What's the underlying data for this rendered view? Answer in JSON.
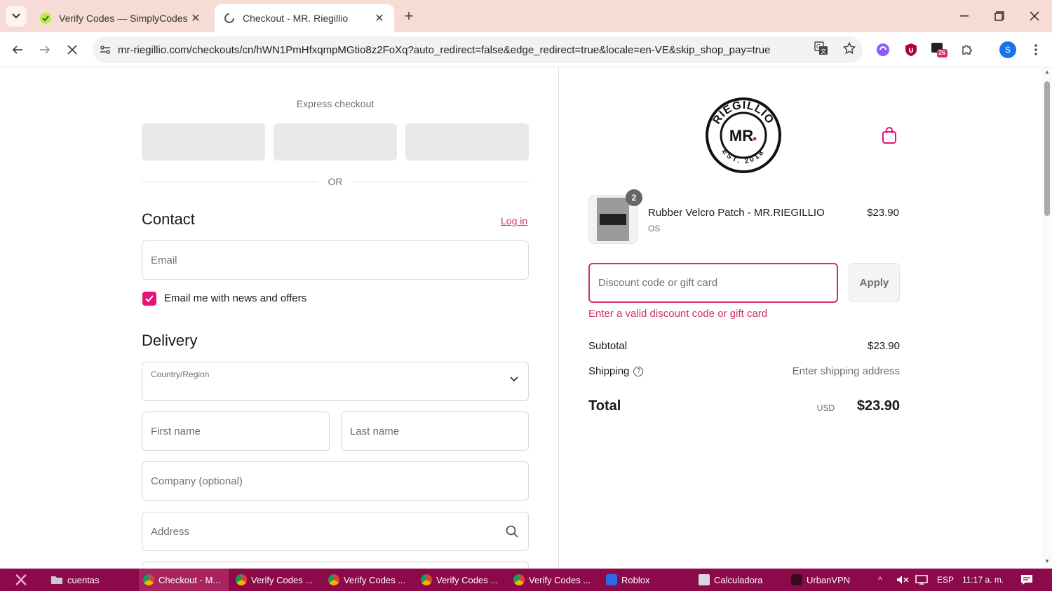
{
  "browser": {
    "tabs": [
      {
        "title": "Verify Codes — SimplyCodes",
        "icon": "simplycodes-icon"
      },
      {
        "title": "Checkout - MR. Riegillio",
        "icon": "loading-icon"
      }
    ],
    "url": "mr-riegillio.com/checkouts/cn/hWN1PmHfxqmpMGtio8z2FoXq?auto_redirect=false&edge_redirect=true&locale=en-VE&skip_shop_pay=true",
    "extension_badge": "26",
    "profile_initial": "S"
  },
  "checkout": {
    "express_title": "Express checkout",
    "or_text": "OR",
    "contact_heading": "Contact",
    "login_link": "Log in",
    "email_placeholder": "Email",
    "newsletter_label": "Email me with news and offers",
    "newsletter_checked": true,
    "delivery_heading": "Delivery",
    "country_label": "Country/Region",
    "first_name_placeholder": "First name",
    "last_name_placeholder": "Last name",
    "company_placeholder": "Company (optional)",
    "address_placeholder": "Address"
  },
  "summary": {
    "item": {
      "name": "Rubber Velcro Patch - MR.RIEGILLIO",
      "variant": "OS",
      "price": "$23.90",
      "quantity": "2"
    },
    "discount_placeholder": "Discount code or gift card",
    "apply_label": "Apply",
    "discount_error": "Enter a valid discount code or gift card",
    "subtotal_label": "Subtotal",
    "subtotal_value": "$23.90",
    "shipping_label": "Shipping",
    "shipping_value": "Enter shipping address",
    "total_label": "Total",
    "total_currency": "USD",
    "total_value": "$23.90",
    "accent_color": "#e5137b",
    "error_color": "#d0306b"
  },
  "taskbar": {
    "items": [
      "cuentas",
      "Checkout - M...",
      "Verify Codes ...",
      "Verify Codes ...",
      "Verify Codes ...",
      "Verify Codes ...",
      "Roblox",
      "Calculadora",
      "UrbanVPN"
    ],
    "language": "ESP",
    "time": "11:17 a. m."
  }
}
